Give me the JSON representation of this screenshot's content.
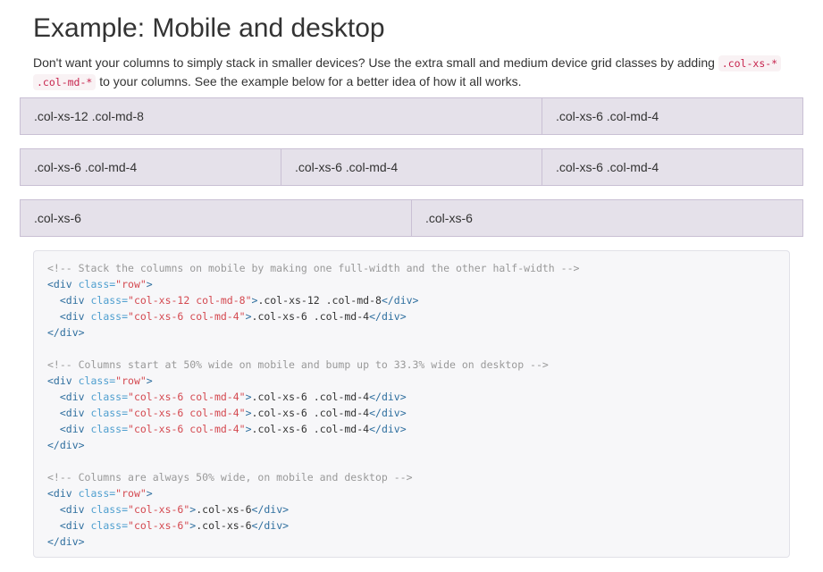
{
  "heading": "Example: Mobile and desktop",
  "lead": {
    "part1": "Don't want your columns to simply stack in smaller devices? Use the extra small and medium device grid classes by adding ",
    "code1": ".col-xs-*",
    "code2": ".col-md-*",
    "part2": " to your columns. See the example below for a better idea of how it all works."
  },
  "rows": [
    {
      "cols": [
        {
          "label": ".col-xs-12 .col-md-8"
        },
        {
          "label": ".col-xs-6 .col-md-4"
        }
      ]
    },
    {
      "cols": [
        {
          "label": ".col-xs-6 .col-md-4"
        },
        {
          "label": ".col-xs-6 .col-md-4"
        },
        {
          "label": ".col-xs-6 .col-md-4"
        }
      ]
    },
    {
      "cols": [
        {
          "label": ".col-xs-6"
        },
        {
          "label": ".col-xs-6"
        }
      ]
    }
  ],
  "code": {
    "comment1": "<!-- Stack the columns on mobile by making one full-width and the other half-width -->",
    "comment2": "<!-- Columns start at 50% wide on mobile and bump up to 33.3% wide on desktop -->",
    "comment3": "<!-- Columns are always 50% wide, on mobile and desktop -->",
    "div_open": "<div",
    "div_close": "</div>",
    "gt": ">",
    "class_attr": " class=",
    "row_val": "\"row\"",
    "val_xs12_md8": "\"col-xs-12 col-md-8\"",
    "val_xs6_md4": "\"col-xs-6 col-md-4\"",
    "val_xs6": "\"col-xs-6\"",
    "text_xs12_md8": ".col-xs-12 .col-md-8",
    "text_xs6_md4": ".col-xs-6 .col-md-4",
    "text_xs6": ".col-xs-6",
    "indent": "  "
  }
}
